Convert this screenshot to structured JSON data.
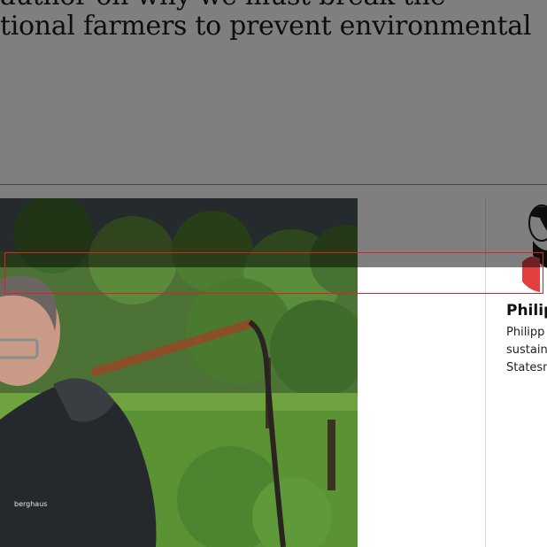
{
  "article": {
    "headline_line1": "author on why we must break the",
    "headline_line2": "tional farmers to prevent environmental"
  },
  "photo": {
    "jacket_brand": "berghaus"
  },
  "author": {
    "name": "Philip",
    "bio_line1": "Philipp",
    "bio_line2": "sustain",
    "bio_line3": "Statesm"
  },
  "colors": {
    "scrim": "#000000",
    "selection_outline": "#e02020",
    "author_accent": "#e04040"
  }
}
